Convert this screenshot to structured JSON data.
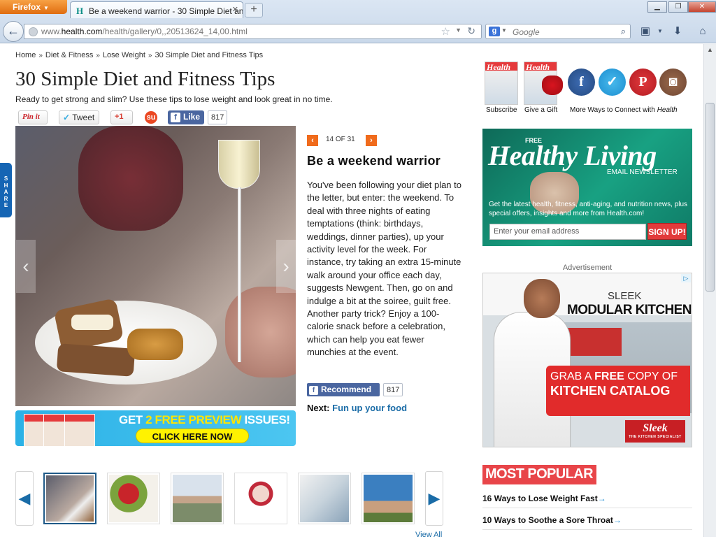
{
  "browser": {
    "app_button": "Firefox",
    "tab_title": "Be a weekend warrior - 30 Simple Diet an...",
    "url_prefix": "www.",
    "url_domain": "health.com",
    "url_path": "/health/gallery/0,,20513624_14,00.html",
    "search_placeholder": "Google"
  },
  "breadcrumb": {
    "items": [
      "Home",
      "Diet & Fitness",
      "Lose Weight",
      "30 Simple Diet and Fitness Tips"
    ],
    "separator": "»"
  },
  "page": {
    "title": "30 Simple Diet and Fitness Tips",
    "subtitle": "Ready to get strong and slim? Use these tips to lose weight and look great in no time."
  },
  "share_bar": {
    "pinit": "Pin it",
    "tweet": "Tweet",
    "gplus": "+1",
    "like": "Like",
    "like_count": "817"
  },
  "side_tab": {
    "label": "SHARE"
  },
  "promo": {
    "headline_a": "GET ",
    "headline_b": "2 FREE PREVIEW",
    "headline_c": " ISSUES!",
    "cta": "CLICK HERE NOW"
  },
  "slide": {
    "counter": "14 OF 31",
    "title": "Be a weekend warrior",
    "body": "You've been following your diet plan to the letter, but enter: the weekend. To deal with three nights of eating temptations (think: birthdays, weddings, dinner parties), up your activity level for the week. For instance, try taking an extra 15-minute walk around your office each day, suggests Newgent. Then, go on and indulge a bit at the soiree, guilt free. Another party trick? Enjoy a 100-calorie snack before a celebration, which can help you eat fewer munchies at the event.",
    "recommend": "Recommend",
    "recommend_count": "817",
    "next_label": "Next:",
    "next_link": "Fun up your food"
  },
  "right": {
    "subscribe": "Subscribe",
    "give_gift": "Give a Gift",
    "more_ways": "More Ways to Connect with ",
    "more_ways_brand": "Health",
    "newsletter": {
      "free": "FREE",
      "headline": "Healthy Living",
      "type": "EMAIL NEWSLETTER",
      "desc": "Get the latest health, fitness, anti-aging, and nutrition news, plus special offers, insights and more from Health.com!",
      "email_placeholder": "Enter your email address",
      "signup": "SIGN UP!"
    },
    "ad_label": "Advertisement",
    "ad": {
      "sleek": "SLEEK",
      "modular": "MODULAR KITCHEN",
      "grab_a": "GRAB A ",
      "grab_b": "FREE",
      "grab_c": " COPY OF",
      "catalog": "KITCHEN CATALOG",
      "logo": "Sleek",
      "logo_sub": "THE KITCHEN SPECIALIST"
    },
    "most_popular": "MOST POPULAR",
    "popular": [
      "16 Ways to Lose Weight Fast",
      "10 Ways to Soothe a Sore Throat"
    ]
  },
  "thumbs": {
    "caption": "View All"
  },
  "colors": {
    "accent_orange": "#f06b1c",
    "link_blue": "#1a6ca7",
    "popular_red": "#e84549",
    "facebook_blue": "#4a66a0"
  }
}
